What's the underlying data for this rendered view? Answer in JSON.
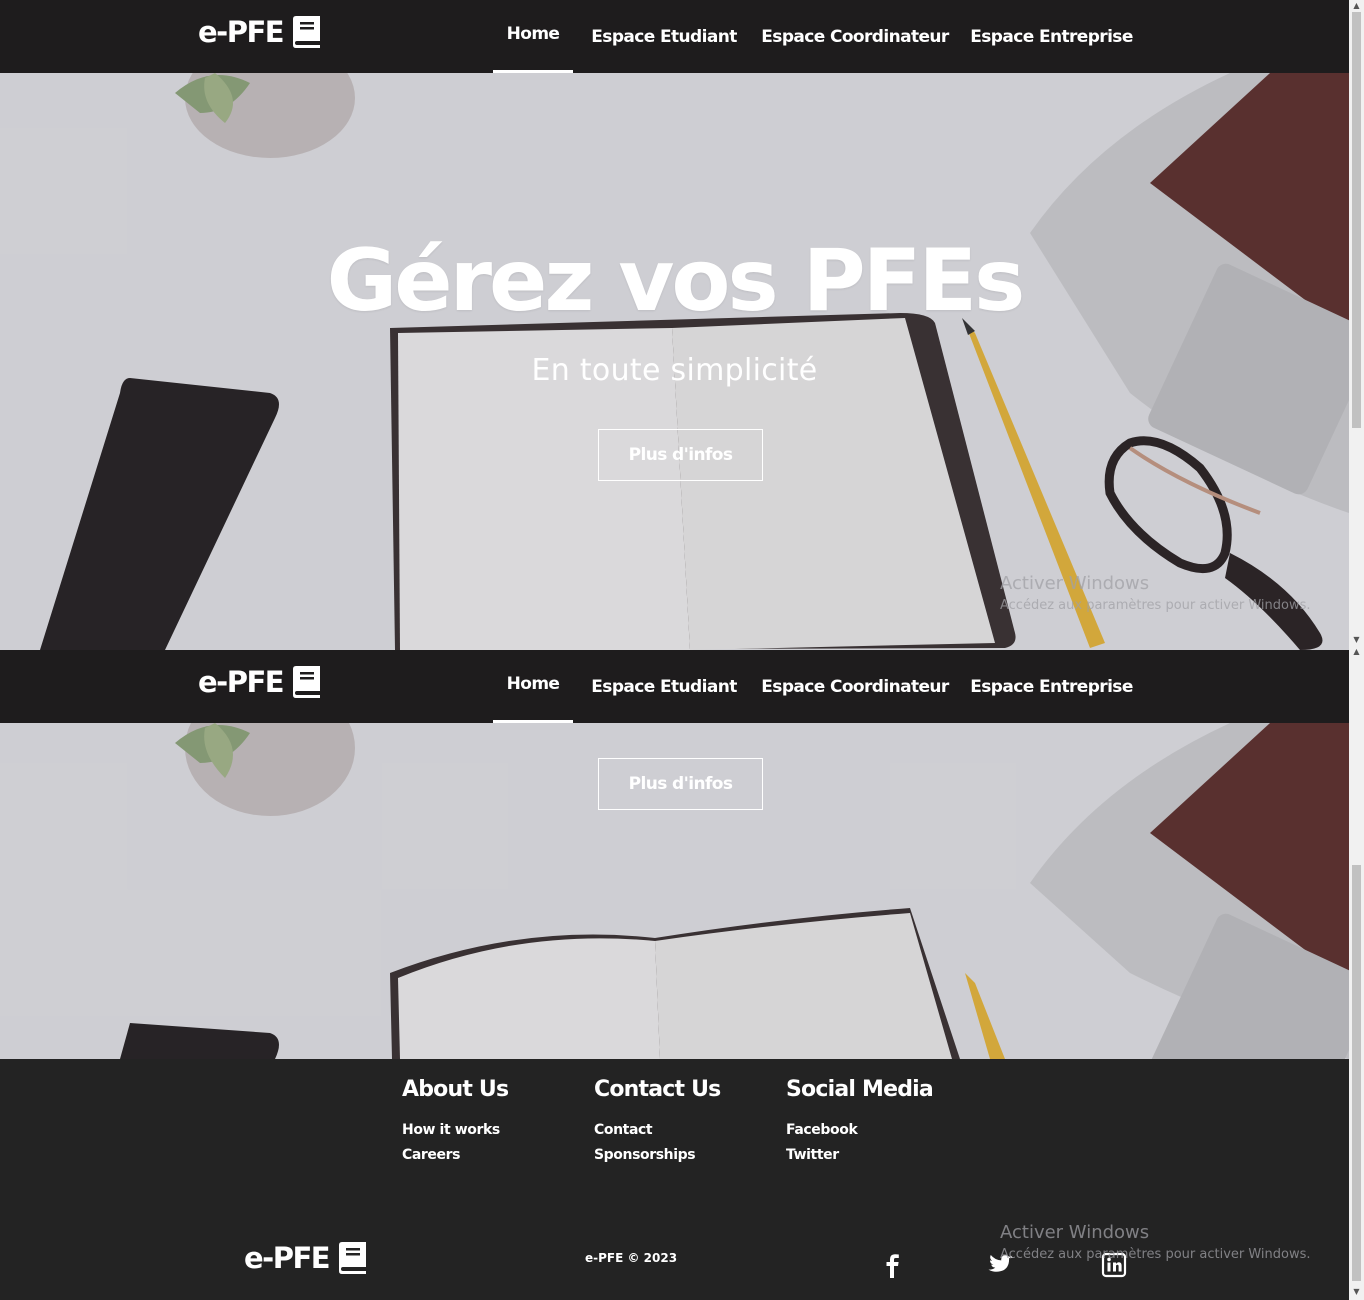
{
  "brand": {
    "name": "e-PFE"
  },
  "nav": {
    "items": [
      {
        "label": "Home",
        "active": true
      },
      {
        "label": "Espace Etudiant",
        "active": false
      },
      {
        "label": "Espace Coordinateur",
        "active": false
      },
      {
        "label": "Espace Entreprise",
        "active": false
      }
    ]
  },
  "hero": {
    "title": "Gérez vos PFEs",
    "subtitle": "En toute simplicité",
    "button_label": "Plus d'infos"
  },
  "footer": {
    "columns": [
      {
        "title": "About Us",
        "links": [
          "How it works",
          "Careers"
        ]
      },
      {
        "title": "Contact Us",
        "links": [
          "Contact",
          "Sponsorships"
        ]
      },
      {
        "title": "Social Media",
        "links": [
          "Facebook",
          "Twitter"
        ]
      }
    ],
    "brand": "e-PFE",
    "copyright": "e-PFE © 2023",
    "social_icons": [
      "facebook-icon",
      "twitter-icon",
      "linkedin-icon"
    ]
  },
  "watermark": {
    "title": "Activer Windows",
    "text": "Accédez aux paramètres pour activer Windows."
  },
  "colors": {
    "navbar": "#1e1c1d",
    "footer": "#232323",
    "text": "#ffffff"
  }
}
